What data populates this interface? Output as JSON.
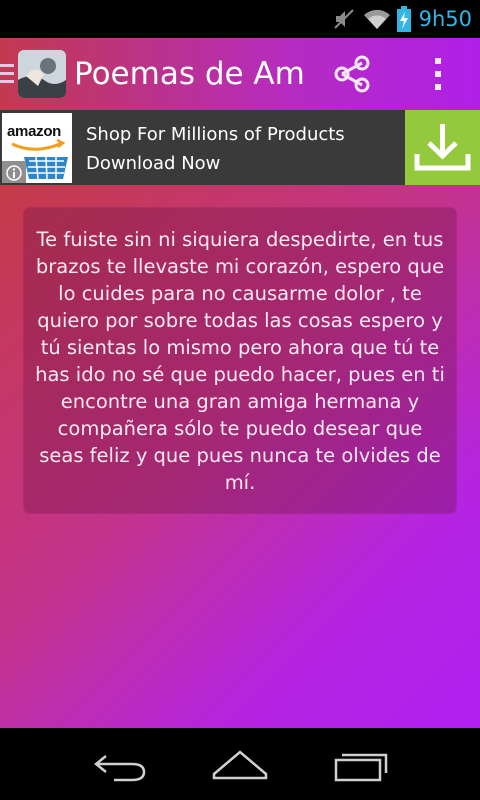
{
  "status_bar": {
    "time": "9h50",
    "icons": [
      "mute-icon",
      "wifi-icon",
      "battery-charging-icon"
    ],
    "accent": "#33b5e5"
  },
  "app_bar": {
    "title": "Poemas de Ami",
    "icons": [
      "drawer-icon",
      "share-icon",
      "overflow-menu-icon"
    ],
    "gradient": [
      "#c23a4e",
      "#b01fe8"
    ]
  },
  "ad": {
    "brand": "amazon",
    "line1": "Shop For Millions of Products",
    "line2": "Download Now",
    "icons": [
      "info-icon",
      "download-icon"
    ],
    "button_color": "#95c93d"
  },
  "poem": {
    "text": "Te fuiste sin ni siquiera despedirte, en tus brazos te llevaste mi corazón, espero que lo cuides para no causarme dolor , te quiero por sobre todas las cosas espero y tú sientas lo mismo pero ahora que tú te has ido no sé que puedo hacer, pues en ti encontre una gran amiga hermana y compañera sólo te puedo desear que seas feliz y que pues nunca te olvides de mí."
  },
  "nav_bar": {
    "icons": [
      "back-icon",
      "home-icon",
      "recent-apps-icon"
    ]
  }
}
